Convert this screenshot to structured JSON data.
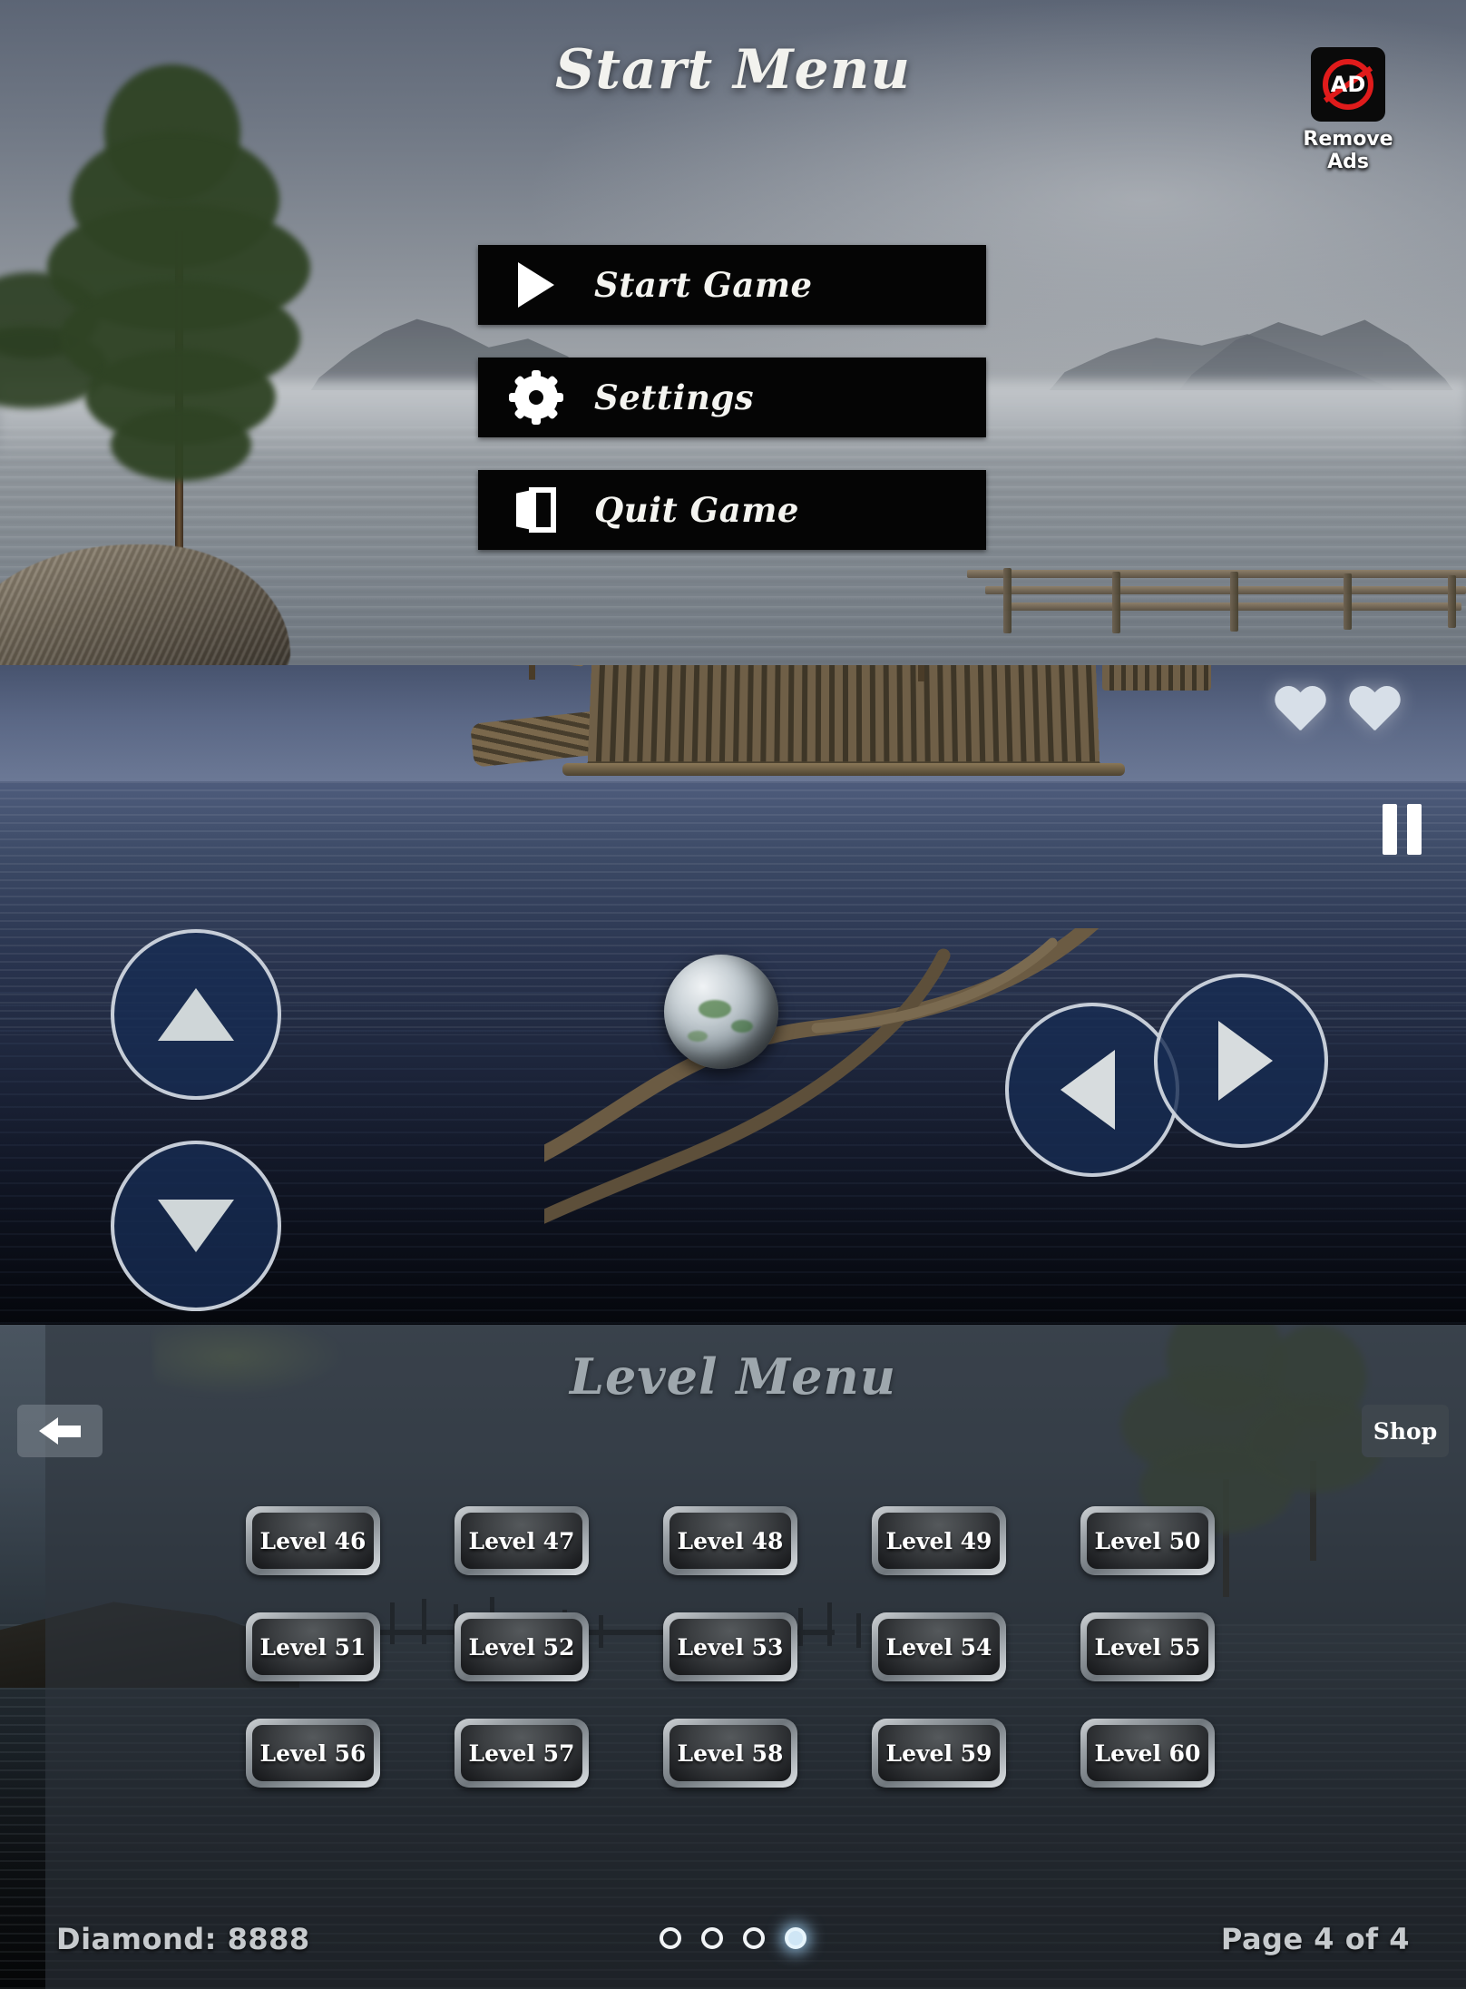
{
  "start_menu": {
    "title": "Start Menu",
    "remove_ads": {
      "label": "Remove Ads",
      "badge_text": "AD",
      "icon": "no-ads-icon",
      "color": "#e01b1b"
    },
    "buttons": [
      {
        "label": "Start Game",
        "icon": "play-icon"
      },
      {
        "label": "Settings",
        "icon": "gear-icon"
      },
      {
        "label": "Quit Game",
        "icon": "exit-door-icon"
      }
    ]
  },
  "gameplay": {
    "hearts": 2,
    "pause_icon": "pause-icon",
    "gem_color": "#25d12a",
    "controls": [
      {
        "name": "up",
        "icon": "triangle-up-icon"
      },
      {
        "name": "down",
        "icon": "triangle-down-icon"
      },
      {
        "name": "left",
        "icon": "triangle-left-icon"
      },
      {
        "name": "right",
        "icon": "triangle-right-icon"
      }
    ],
    "control_color": "#162c52"
  },
  "level_menu": {
    "title": "Level Menu",
    "back_icon": "arrow-left-icon",
    "shop_label": "Shop",
    "levels": [
      "Level 46",
      "Level 47",
      "Level 48",
      "Level 49",
      "Level 50",
      "Level 51",
      "Level 52",
      "Level 53",
      "Level 54",
      "Level 55",
      "Level 56",
      "Level 57",
      "Level 58",
      "Level 59",
      "Level 60"
    ],
    "footer": {
      "diamond": "Diamond: 8888",
      "page": "Page 4 of 4",
      "pages_total": 4,
      "page_active_index": 3
    }
  }
}
